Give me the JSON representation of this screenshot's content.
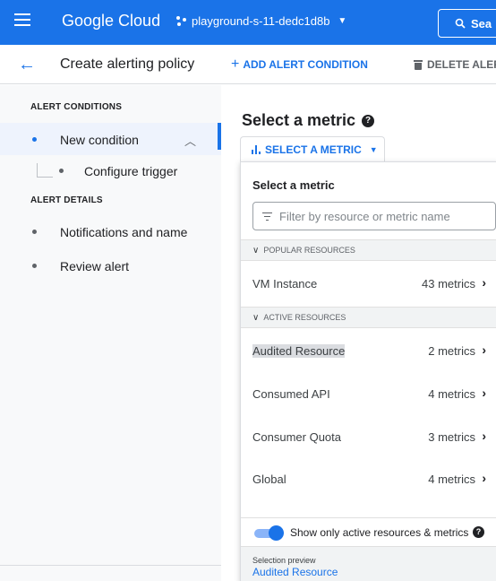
{
  "topbar": {
    "logo": "Google Cloud",
    "project": "playground-s-11-dedc1d8b",
    "search_label": "Sea"
  },
  "subbar": {
    "title": "Create alerting policy",
    "add_condition": "ADD ALERT CONDITION",
    "delete_alert": "DELETE ALER"
  },
  "sidebar": {
    "alert_conditions_title": "ALERT CONDITIONS",
    "new_condition": "New condition",
    "configure_trigger": "Configure trigger",
    "alert_details_title": "ALERT DETAILS",
    "notifications": "Notifications and name",
    "review": "Review alert"
  },
  "main": {
    "title": "Select a metric",
    "select_button": "SELECT A METRIC"
  },
  "dropdown": {
    "heading": "Select a metric",
    "filter_placeholder": "Filter by resource or metric name",
    "popular_header": "POPULAR RESOURCES",
    "popular": [
      {
        "name": "VM Instance",
        "count": "43 metrics"
      }
    ],
    "active_header": "ACTIVE RESOURCES",
    "active": [
      {
        "name": "Audited Resource",
        "count": "2 metrics"
      },
      {
        "name": "Consumed API",
        "count": "4 metrics"
      },
      {
        "name": "Consumer Quota",
        "count": "3 metrics"
      },
      {
        "name": "Global",
        "count": "4 metrics"
      }
    ],
    "toggle_label": "Show only active resources & metrics",
    "toggle_on": true,
    "preview_label": "Selection preview",
    "preview_value": "Audited Resource"
  },
  "colors": {
    "brand": "#1a73e8",
    "highlight": "#dadce0"
  }
}
